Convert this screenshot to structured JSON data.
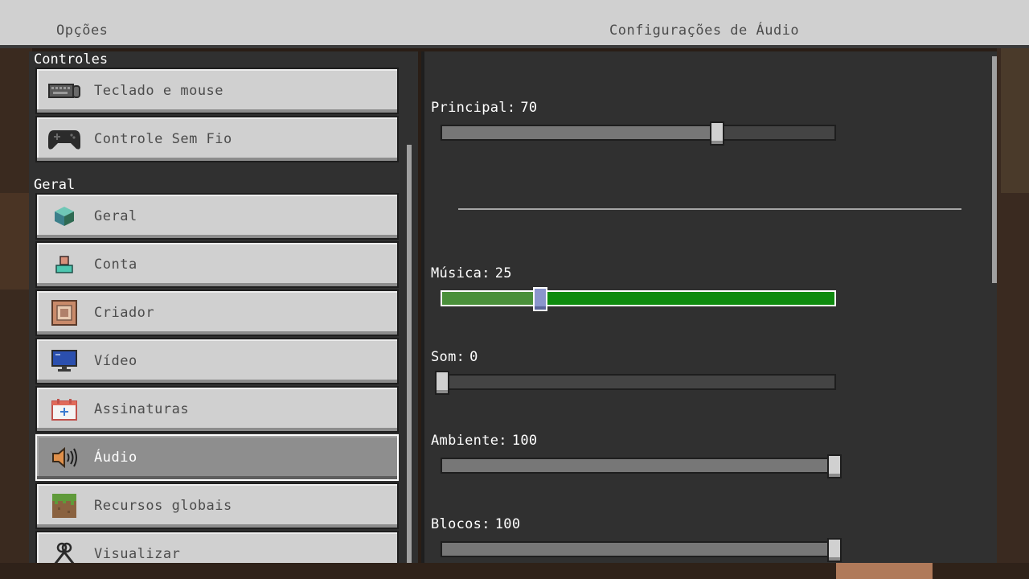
{
  "header": {
    "left_title": "Opções",
    "center_title": "Configurações de Áudio"
  },
  "sidebar": {
    "sections": [
      {
        "label": "Controles",
        "items": [
          {
            "label": "Teclado e mouse",
            "icon": "keyboard-mouse-icon"
          },
          {
            "label": "Controle Sem Fio",
            "icon": "gamepad-icon"
          }
        ]
      },
      {
        "label": "Geral",
        "items": [
          {
            "label": "Geral",
            "icon": "cube-icon"
          },
          {
            "label": "Conta",
            "icon": "account-icon"
          },
          {
            "label": "Criador",
            "icon": "creator-icon"
          },
          {
            "label": "Vídeo",
            "icon": "monitor-icon"
          },
          {
            "label": "Assinaturas",
            "icon": "subscriptions-icon"
          },
          {
            "label": "Áudio",
            "icon": "speaker-icon",
            "active": true
          },
          {
            "label": "Recursos globais",
            "icon": "grass-block-icon"
          },
          {
            "label": "Visualizar",
            "icon": "tools-icon"
          }
        ]
      }
    ]
  },
  "audio": {
    "sliders": [
      {
        "key": "principal",
        "label": "Principal:",
        "value": 70,
        "max": 100
      },
      {
        "key": "musica",
        "label": "Música:",
        "value": 25,
        "max": 100,
        "focused": true
      },
      {
        "key": "som",
        "label": "Som:",
        "value": 0,
        "max": 100
      },
      {
        "key": "ambiente",
        "label": "Ambiente:",
        "value": 100,
        "max": 100
      },
      {
        "key": "blocos",
        "label": "Blocos:",
        "value": 100,
        "max": 100
      }
    ]
  },
  "colors": {
    "panel_bg": "#303030",
    "button_bg": "#d0d0d0",
    "active_button_bg": "#8e8e8e",
    "focused_track": "#0e8a0e",
    "focused_handle": "#8a95cc"
  }
}
